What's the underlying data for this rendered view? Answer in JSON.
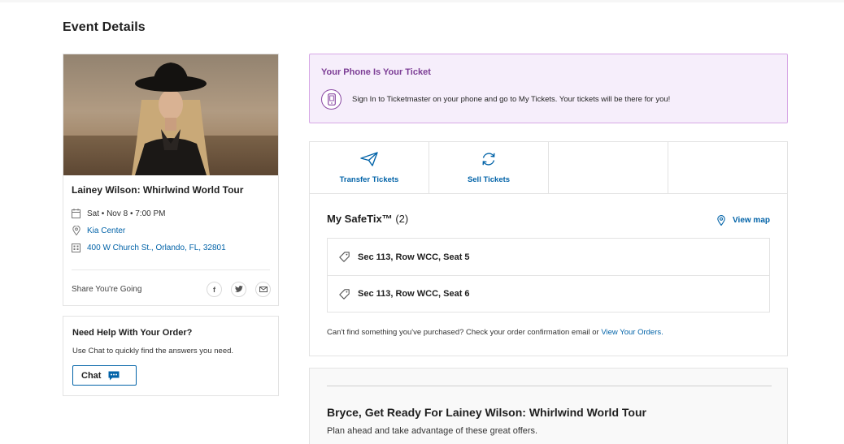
{
  "page": {
    "title": "Event Details"
  },
  "event": {
    "name": "Lainey Wilson: Whirlwind World Tour",
    "datetime": "Sat • Nov 8 • 7:00 PM",
    "venue": "Kia Center",
    "address": "400 W Church St., Orlando, FL, 32801",
    "share_label": "Share You're Going",
    "share_icons": [
      "facebook-icon",
      "twitter-icon",
      "email-icon"
    ]
  },
  "help": {
    "title": "Need Help With Your Order?",
    "text": "Use Chat to quickly find the answers you need.",
    "chat_label": "Chat"
  },
  "phone_banner": {
    "title": "Your Phone Is Your Ticket",
    "text": "Sign In to Ticketmaster on your phone and go to My Tickets. Your tickets will be there for you!"
  },
  "actions": [
    {
      "label": "Transfer Tickets",
      "icon": "paper-plane-icon"
    },
    {
      "label": "Sell Tickets",
      "icon": "refresh-icon"
    }
  ],
  "safetix": {
    "title": "My SafeTix™",
    "count": "(2)",
    "view_map": "View map",
    "seats": [
      "Sec 113, Row WCC, Seat 5",
      "Sec 113, Row WCC, Seat 6"
    ],
    "cant_find_text": "Can't find something you've purchased? Check your order confirmation email or",
    "cant_find_link": "View Your Orders."
  },
  "promo": {
    "title": "Bryce, Get Ready For Lainey Wilson: Whirlwind World Tour",
    "subtitle": "Plan ahead and take advantage of these great offers."
  },
  "colors": {
    "link": "#0263a8",
    "banner_bg": "#f6eefb",
    "banner_border": "#d7a8e6",
    "banner_title": "#7c3d95"
  }
}
